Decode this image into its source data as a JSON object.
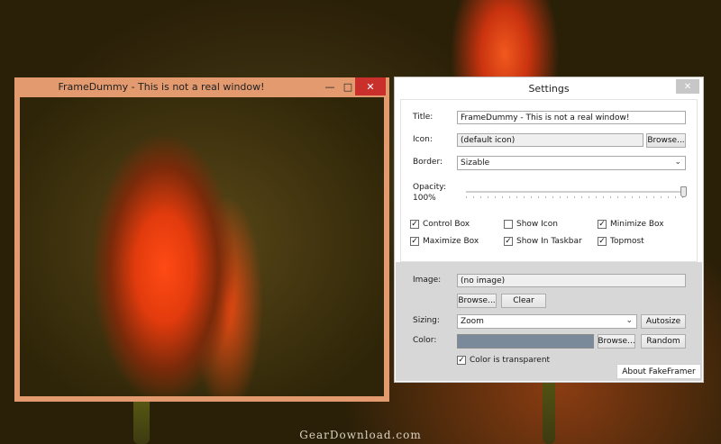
{
  "framedummy": {
    "title": "FrameDummy - This is not a real window!",
    "minimize": "—",
    "maximize": "□",
    "close": "✕"
  },
  "settings": {
    "title": "Settings",
    "close": "✕",
    "title_label": "Title:",
    "title_value": "FrameDummy - This is not a real window!",
    "icon_label": "Icon:",
    "icon_value": "(default icon)",
    "icon_browse": "Browse...",
    "border_label": "Border:",
    "border_value": "Sizable",
    "opacity_label": "Opacity:",
    "opacity_value": "100%",
    "opacity_fraction": 1.0,
    "checkboxes": [
      {
        "label": "Control Box",
        "checked": true
      },
      {
        "label": "Show Icon",
        "checked": false
      },
      {
        "label": "Minimize Box",
        "checked": true
      },
      {
        "label": "Maximize Box",
        "checked": true
      },
      {
        "label": "Show In Taskbar",
        "checked": true
      },
      {
        "label": "Topmost",
        "checked": true
      }
    ],
    "image_label": "Image:",
    "image_value": "(no image)",
    "image_browse": "Browse...",
    "image_clear": "Clear",
    "sizing_label": "Sizing:",
    "sizing_value": "Zoom",
    "autosize": "Autosize",
    "color_label": "Color:",
    "color_value": "#7a8a9a",
    "color_browse": "Browse...",
    "color_random": "Random",
    "transparent_label": "Color is transparent",
    "transparent_checked": true,
    "about": "About FakeFramer"
  },
  "watermark": "GearDownload.com"
}
